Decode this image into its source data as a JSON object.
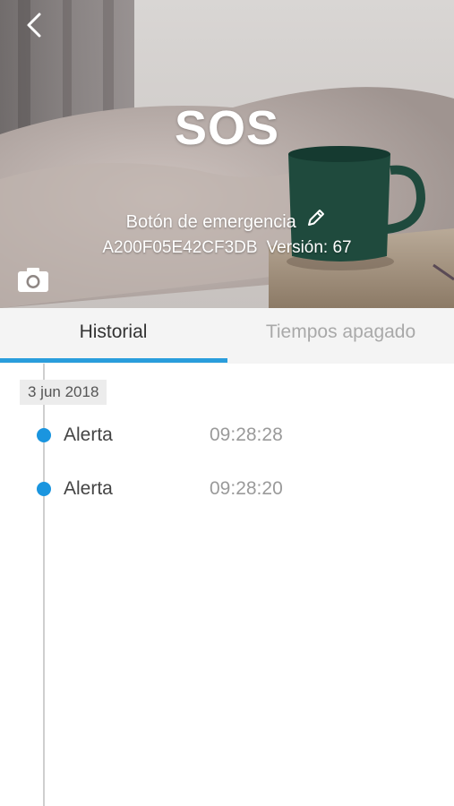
{
  "header": {
    "title": "SOS",
    "device_name": "Botón de emergencia",
    "device_id": "A200F05E42CF3DB",
    "version": "Versión: 67",
    "back_icon": "chevron-left-icon",
    "edit_icon": "pencil-icon",
    "camera_icon": "camera-icon"
  },
  "tabs": [
    {
      "label": "Historial",
      "active": true
    },
    {
      "label": "Tiempos apagado",
      "active": false
    }
  ],
  "history": {
    "date": "3 jun 2018",
    "events": [
      {
        "label": "Alerta",
        "time": "09:28:28"
      },
      {
        "label": "Alerta",
        "time": "09:28:20"
      }
    ]
  },
  "colors": {
    "accent": "#2a9ddc",
    "dot": "#1a95df",
    "tab_bg": "#f4f4f4"
  }
}
